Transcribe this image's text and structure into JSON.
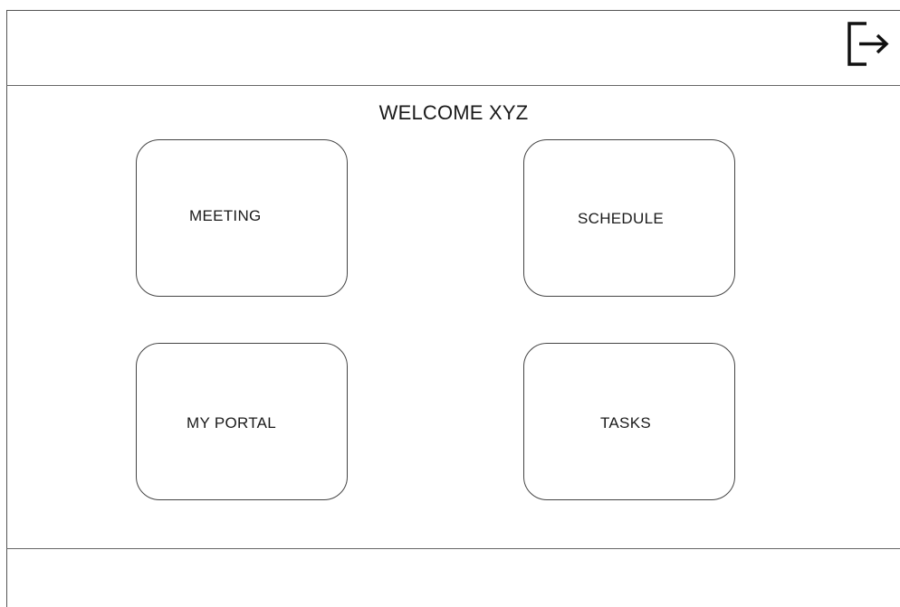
{
  "header": {
    "logout_icon": "logout-icon"
  },
  "main": {
    "welcome_text": "WELCOME XYZ",
    "tiles": [
      {
        "label": "MEETING"
      },
      {
        "label": "SCHEDULE"
      },
      {
        "label": "MY PORTAL"
      },
      {
        "label": "TASKS"
      }
    ]
  }
}
